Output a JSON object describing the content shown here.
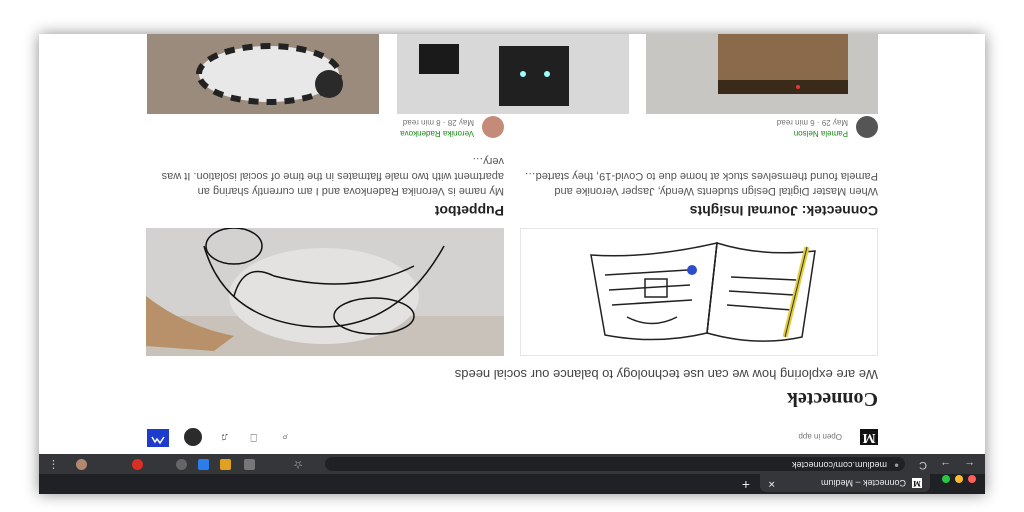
{
  "browser": {
    "tab_title": "Connectek – Medium",
    "tab_close": "✕",
    "new_tab": "+",
    "favicon_letter": "M",
    "url": "medium.com/connectek",
    "back": "←",
    "forward": "→",
    "reload": "C",
    "lock": "●",
    "star": "☆",
    "menu": "⋮"
  },
  "header": {
    "logo_letter": "M",
    "open_in_app": "Open in app",
    "search_icon": "⌕",
    "bookmark_icon": "⎕",
    "bell_icon": "♫"
  },
  "publication": {
    "title": "Connectek",
    "tagline": "We are exploring how we can use technology to balance our social needs"
  },
  "posts": [
    {
      "title": "Connectek: Journal Insights",
      "excerpt": "When Master Digital Design students Wendy, Jasper Veronike and Pamela found themselves stuck at home due to Covid-19, they started…",
      "author": "Pamela Nelson",
      "date": "May 29 · 6 min read"
    },
    {
      "title": "Puppetbot",
      "excerpt": "My name is Veronika Radenkova and I am currently sharing an apartment with two male flatmates in the time of social isolation. It was very…",
      "author": "Veronika Radenkova",
      "date": "May 28 · 8 min read"
    }
  ],
  "colors": {
    "tabbar": "#202124",
    "toolbar": "#35363a",
    "author_green": "#1a8917",
    "publication_logo": "#1d3bcc"
  }
}
